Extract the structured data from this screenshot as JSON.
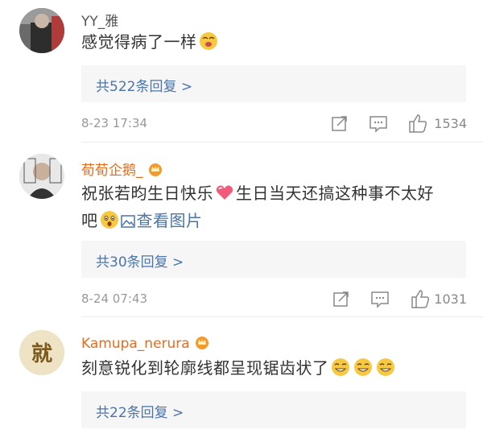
{
  "comments": [
    {
      "username": "YY_雅",
      "text_before": "感觉得病了一样",
      "emoji": "emoji-icon",
      "replies_label": "共522条回复 >",
      "time": "8-23 17:34",
      "likes": "1534"
    },
    {
      "username": "荀荀企鹅_",
      "text_line1_a": "祝张若昀生日快乐",
      "text_line1_b": "生日当天还搞这种事不太好",
      "text_line2": "吧",
      "view_image": "查看图片",
      "replies_label": "共30条回复 >",
      "time": "8-24 07:43",
      "likes": "1031"
    },
    {
      "username": "Kamupa_nerura",
      "text": "刻意锐化到轮廓线都呈现锯齿状了",
      "replies_label": "共22条回复 >"
    }
  ],
  "colors": {
    "orange_username": "#e86b1c",
    "link_blue": "#4b74a8",
    "meta_gray": "#999999"
  }
}
